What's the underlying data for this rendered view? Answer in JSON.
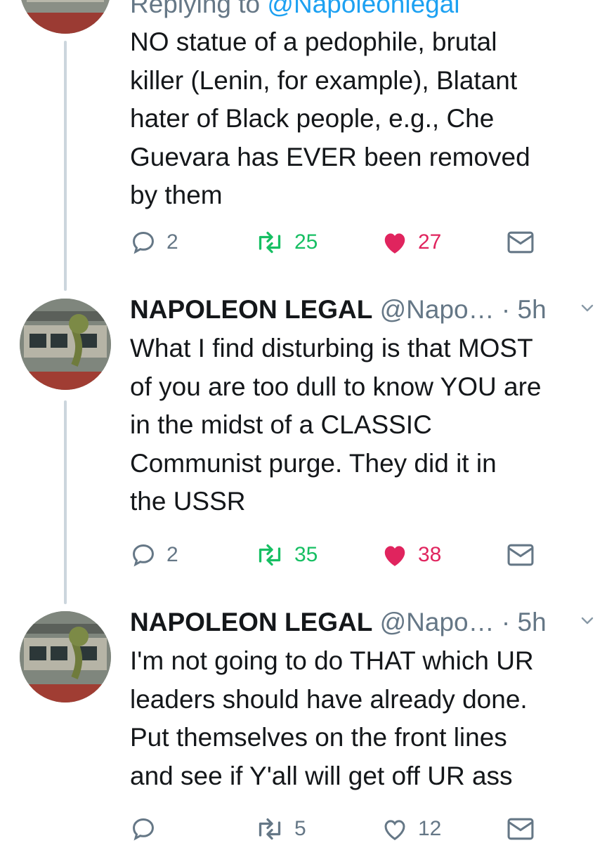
{
  "tweets": [
    {
      "replying_prefix": "Replying to ",
      "replying_handle": "@Napoleonlegal",
      "body": "NO statue of a pedophile, brutal\nkiller (Lenin, for example), Blatant\nhater of Black people, e.g., Che\nGuevara has EVER been removed\nby them",
      "replies": "2",
      "retweets": "25",
      "likes": "27",
      "retweeted": true,
      "liked": true
    },
    {
      "name": "NAPOLEON LEGAL",
      "handle": "@Napo…",
      "dot": "·",
      "time": "5h",
      "body": "What I find disturbing is that MOST\nof you are too dull to know YOU are\nin the midst of a CLASSIC\nCommunist purge.  They did it in\nthe USSR",
      "replies": "2",
      "retweets": "35",
      "likes": "38",
      "retweeted": true,
      "liked": true
    },
    {
      "name": "NAPOLEON LEGAL",
      "handle": "@Napo…",
      "dot": "·",
      "time": "5h",
      "body": "I'm not going to do THAT which UR\nleaders should have already done.\nPut themselves on the front lines\nand see if Y'all will get off UR ass",
      "replies": "",
      "retweets": "5",
      "likes": "12",
      "retweeted": false,
      "liked": false
    }
  ],
  "colors": {
    "text": "#14171a",
    "secondary": "#657786",
    "link": "#1da1f2",
    "retweet": "#17bf63",
    "like": "#e0245e",
    "thread_line": "#ccd6dd"
  },
  "icons": [
    "reply-icon",
    "retweet-icon",
    "like-icon",
    "direct-message-icon",
    "chevron-down-icon"
  ]
}
